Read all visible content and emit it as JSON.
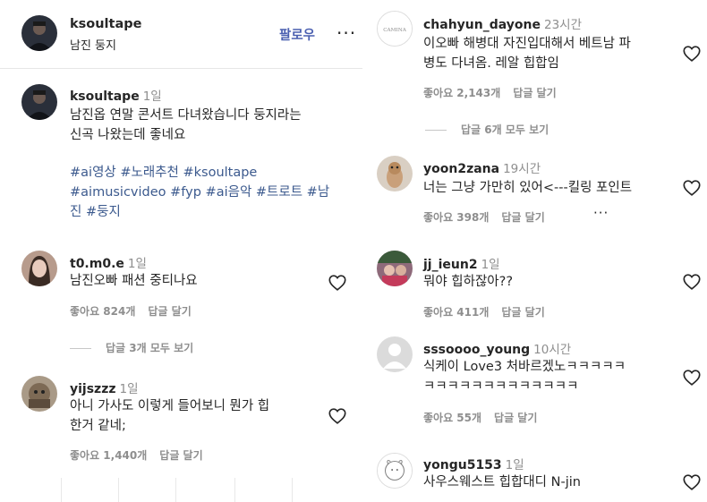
{
  "post": {
    "username": "ksoultape",
    "subtitle": "남진 둥지",
    "follow_label": "팔로우",
    "more_label": "···",
    "caption": {
      "username": "ksoultape",
      "time": "1일",
      "line1": "남진옵 연말 콘서트 다녀왔습니다 둥지라는",
      "line2": "신곡 나왔는데 좋네요",
      "tags_line1": "#ai영상 #노래추천 #ksoultape",
      "tags_line2": "#aimusicvideo #fyp #ai음악 #트로트 #남",
      "tags_line3": "진 #둥지"
    }
  },
  "left_comments": [
    {
      "username": "t0.m0.e",
      "time": "1일",
      "text_line1": "남진오빠 패션 중티나요",
      "likes": "좋아요 824개",
      "reply": "답글 달기",
      "view_replies": "답글 3개 모두 보기"
    },
    {
      "username": "yijszzz",
      "time": "1일",
      "text_line1": "아니 가사도 이렇게 들어보니 뭔가 힙",
      "text_line2": "한거 같네;",
      "likes": "좋아요 1,440개",
      "reply": "답글 달기"
    }
  ],
  "right_comments": [
    {
      "username": "chahyun_dayone",
      "time": "23시간",
      "text_line1": "이오빠 해병대 자진입대해서 베트남 파",
      "text_line2": "병도 다녀옴. 레알 힙합임",
      "likes": "좋아요 2,143개",
      "reply": "답글 달기",
      "view_replies": "답글 6개 모두 보기"
    },
    {
      "username": "yoon2zana",
      "time": "19시간",
      "text_line1": "너는 그냥 가만히 있어<---킬링 포인트",
      "likes": "좋아요 398개",
      "reply": "답글 달기",
      "more": "···"
    },
    {
      "username": "jj_ieun2",
      "time": "1일",
      "text_line1": "뭐야 힙하잖아??",
      "likes": "좋아요 411개",
      "reply": "답글 달기"
    },
    {
      "username": "sssoooo_young",
      "time": "10시간",
      "text_line1": "식케이 Love3 처바르겠노ㅋㅋㅋㅋㅋ",
      "text_line2": "ㅋㅋㅋㅋㅋㅋㅋㅋㅋㅋㅋㅋㅋ",
      "likes": "좋아요 55개",
      "reply": "답글 달기"
    },
    {
      "username": "yongu5153",
      "time": "1일",
      "text_line1": "사우스웨스트 힙합대디 N-jin"
    }
  ],
  "colors": {
    "follow": "#4a5fb0",
    "hashtag": "#3c5a8e",
    "muted": "#8e8e8e"
  },
  "icons": {
    "like": "heart-outline-icon",
    "more": "more-horizontal-icon"
  }
}
